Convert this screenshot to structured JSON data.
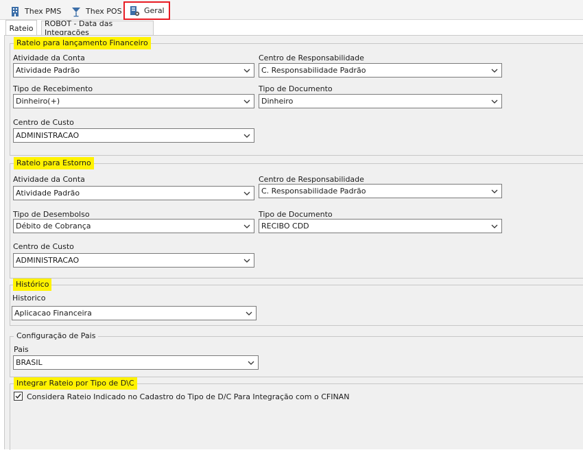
{
  "top_tabs": [
    {
      "label": "Thex PMS"
    },
    {
      "label": "Thex POS"
    },
    {
      "label": "Geral"
    }
  ],
  "sub_tabs": [
    {
      "label": "Rateio"
    },
    {
      "label": "ROBOT - Data das Integrações"
    }
  ],
  "rateio_financeiro": {
    "title": "Rateio para lançamento Financeiro",
    "atividade_label": "Atividade da Conta",
    "atividade_value": "Atividade Padrão",
    "centro_resp_label": "Centro de Responsabilidade",
    "centro_resp_value": "C. Responsabilidade Padrão",
    "tipo_receb_label": "Tipo de Recebimento",
    "tipo_receb_value": "Dinheiro(+)",
    "tipo_doc_label": "Tipo de Documento",
    "tipo_doc_value": "Dinheiro",
    "centro_custo_label": "Centro de Custo",
    "centro_custo_value": "ADMINISTRACAO"
  },
  "rateio_estorno": {
    "title": "Rateio para Estorno",
    "atividade_label": "Atividade da Conta",
    "atividade_value": "Atividade Padrão",
    "centro_resp_label": "Centro de Responsabilidade",
    "centro_resp_value": "C. Responsabilidade Padrão",
    "tipo_desemb_label": "Tipo de Desembolso",
    "tipo_desemb_value": "Débito de Cobrança",
    "tipo_doc_label": "Tipo de Documento",
    "tipo_doc_value": "RECIBO CDD",
    "centro_custo_label": "Centro de Custo",
    "centro_custo_value": "ADMINISTRACAO"
  },
  "historico": {
    "title": "Histórico",
    "label": "Historico",
    "value": "Aplicacao Financeira"
  },
  "config_pais": {
    "title": "Configuração de Pais",
    "label": "Pais",
    "value": "BRASIL"
  },
  "integrar": {
    "title": "Integrar Rateio por Tipo de D\\C",
    "checkbox_label": "Considera Rateio Indicado no Cadastro do Tipo de D/C Para Integração com o CFINAN",
    "checked": true
  },
  "colors": {
    "highlight": "#fff200",
    "annotation_red": "#e81b23",
    "panel_bg": "#f0f0f0"
  }
}
